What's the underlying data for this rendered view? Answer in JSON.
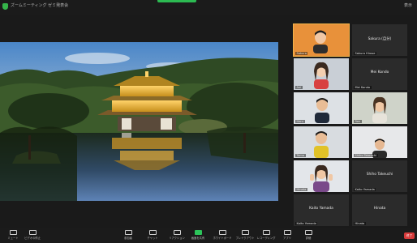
{
  "window": {
    "title": "ズームミーティング ゼミ発表会",
    "view_label": "表示"
  },
  "participants": [
    {
      "id": "p1",
      "name": "Sakura",
      "label": "Sakura (自分)",
      "active": true
    },
    {
      "id": "p2",
      "name": "Sakura Hirose",
      "label": "Sakura Hirose 🔇",
      "active": false
    },
    {
      "id": "p3",
      "name": "Aoi",
      "label": "Aoi",
      "active": false
    },
    {
      "id": "p4",
      "name": "Mei Kondo",
      "label": "Mei Kondo",
      "active": false
    },
    {
      "id": "p5",
      "name": "Haru",
      "label": "Haru",
      "active": false
    },
    {
      "id": "p6",
      "name": "Ren",
      "label": "Ren",
      "active": false
    },
    {
      "id": "p7",
      "name": "Toma",
      "label": "Toma",
      "active": false
    },
    {
      "id": "p8",
      "name": "Shiho Takeuchi",
      "label": "Shiho Takeuchi",
      "active": false
    },
    {
      "id": "p9",
      "name": "Hinata",
      "label": "Hinata",
      "active": false
    },
    {
      "id": "p10",
      "name": "Kaito Yamada",
      "label": "Kaito Yamada",
      "active": false
    }
  ],
  "toolbar": {
    "buttons": [
      {
        "label": "ミュート",
        "icon": "mic-icon"
      },
      {
        "label": "ビデオの停止",
        "icon": "video-icon"
      },
      {
        "label": "参加者",
        "icon": "participants-icon"
      },
      {
        "label": "チャット",
        "icon": "chat-icon"
      },
      {
        "label": "画面を共有",
        "icon": "share-screen-icon"
      },
      {
        "label": "ホワイトボード",
        "icon": "whiteboard-icon"
      },
      {
        "label": "ブレイクアウト",
        "icon": "breakout-icon"
      },
      {
        "label": "レコーディング",
        "icon": "record-icon"
      },
      {
        "label": "リアクション",
        "icon": "reaction-icon"
      },
      {
        "label": "アプリ",
        "icon": "apps-icon"
      },
      {
        "label": "詳細",
        "icon": "more-icon"
      }
    ],
    "end_label": "終了"
  },
  "colors": {
    "accent_green": "#2cc45a",
    "active_speaker": "#f2b44a",
    "end_red": "#d63a3a"
  }
}
